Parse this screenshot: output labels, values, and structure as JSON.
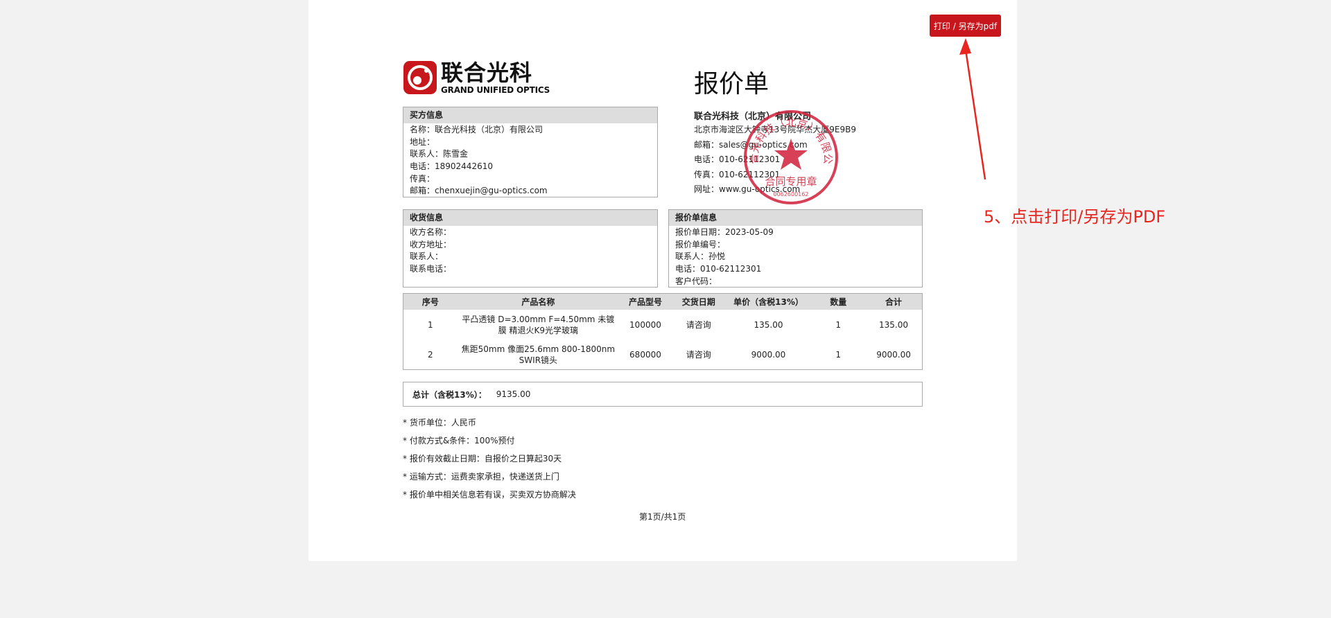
{
  "toolbar": {
    "print_label": "打印 / 另存为pdf"
  },
  "annotation": {
    "step_text": "5、点击打印/另存为PDF"
  },
  "logo": {
    "cn": "联合光科",
    "en": "GRAND UNIFIED OPTICS"
  },
  "doc_title": "报价单",
  "buyer": {
    "heading": "买方信息",
    "rows": [
      "名称：联合光科技（北京）有限公司",
      "地址：",
      "联系人：陈雪金",
      "电话：18902442610",
      "传真：",
      "邮箱：chenxuejin@gu-optics.com"
    ]
  },
  "seller": {
    "name": "联合光科技（北京）有限公司",
    "rows": [
      "北京市海淀区大钟寺13号院华杰大厦9E9B9",
      "邮箱：sales@gu-optics.com",
      "电话：010-62112301",
      "传真：010-62112301",
      "网址：www.gu-optics.com"
    ]
  },
  "seal": {
    "top_text": "联合光科技（北京）有限公司",
    "mid_text": "合同专用章",
    "num_text": "0062600162"
  },
  "shipping": {
    "heading": "收货信息",
    "rows": [
      "收方名称：",
      "收方地址：",
      "联系人：",
      "联系电话："
    ]
  },
  "quote_info": {
    "heading": "报价单信息",
    "rows": [
      "报价单日期：2023-05-09",
      "报价单编号：",
      "联系人：孙悦",
      "电话：010-62112301",
      "客户代码："
    ]
  },
  "items": {
    "headers": [
      "序号",
      "产品名称",
      "产品型号",
      "交货日期",
      "单价（含税13%）",
      "数量",
      "合计"
    ],
    "rows": [
      [
        "1",
        "平凸透镜 D=3.00mm F=4.50mm 未镀膜 精退火K9光学玻璃",
        "100000",
        "请咨询",
        "135.00",
        "1",
        "135.00"
      ],
      [
        "2",
        "焦距50mm 像面25.6mm 800-1800nm SWIR镜头",
        "680000",
        "请咨询",
        "9000.00",
        "1",
        "9000.00"
      ]
    ]
  },
  "total": {
    "label": "总计（含税13%）：",
    "value": "9135.00"
  },
  "notes": [
    "* 货币单位：人民币",
    "* 付款方式&条件：100%预付",
    "* 报价有效截止日期：自报价之日算起30天",
    "* 运输方式：运费卖家承担，快递送货上门",
    "* 报价单中相关信息若有误，买卖双方协商解决"
  ],
  "pager": "第1页/共1页",
  "colors": {
    "brand": "#c8161d",
    "annotation": "#e8251e",
    "header_bg": "#dddddd"
  }
}
